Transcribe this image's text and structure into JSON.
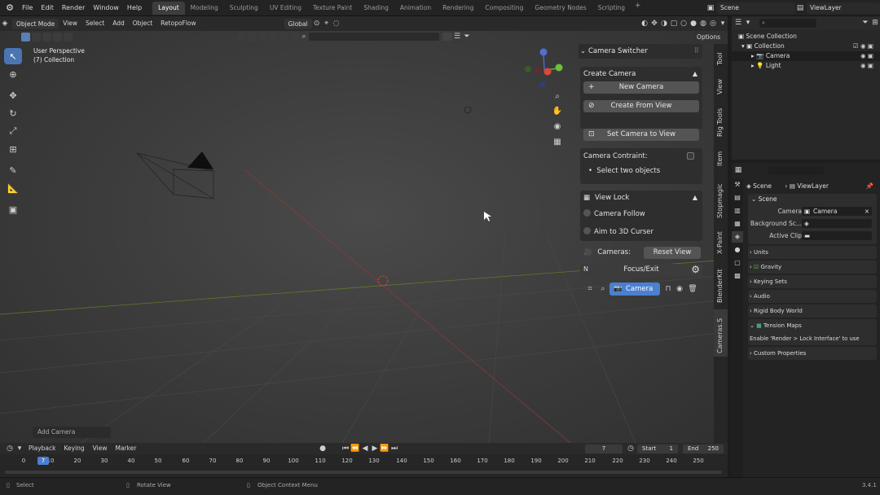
{
  "topbar": {
    "menus": [
      "File",
      "Edit",
      "Render",
      "Window",
      "Help"
    ],
    "workspaces": [
      "Layout",
      "Modeling",
      "Sculpting",
      "UV Editing",
      "Texture Paint",
      "Shading",
      "Animation",
      "Rendering",
      "Compositing",
      "Geometry Nodes",
      "Scripting"
    ],
    "active_workspace": "Layout",
    "scene": "Scene",
    "view_layer": "ViewLayer"
  },
  "viewport_header": {
    "mode": "Object Mode",
    "menus": [
      "View",
      "Select",
      "Add",
      "Object",
      "RetopoFlow"
    ],
    "transform_orientation": "Global",
    "options_label": "Options"
  },
  "viewport": {
    "perspective": "User Perspective",
    "collection": "(7) Collection",
    "last_operator": "Add Camera"
  },
  "npanel": {
    "title": "Camera Switcher",
    "create_camera": {
      "title": "Create Camera",
      "new_camera": "New Camera",
      "create_from_view": "Create From View",
      "set_camera_to_view": "Set Camera to View"
    },
    "contraint": {
      "label": "Camera Contraint:",
      "hint": "Select two objects"
    },
    "view_lock": {
      "title": "View Lock",
      "camera_follow": "Camera Follow",
      "aim_to_cursor": "Aim to 3D Curser"
    },
    "cameras_label": "Cameras:",
    "reset_view": "Reset View",
    "n_key": "N",
    "focus_exit": "Focus/Exit",
    "camera_item": "Camera",
    "tabs": [
      "Tool",
      "View",
      "Rig Tools",
      "Item",
      "Stopmagic",
      "X-Paint",
      "BlenderKit",
      "Cameras.S"
    ]
  },
  "outliner": {
    "scene_collection": "Scene Collection",
    "collection": "Collection",
    "camera": "Camera",
    "light": "Light"
  },
  "properties": {
    "crumb_scene": "Scene",
    "crumb_layer": "ViewLayer",
    "scene_panel": "Scene",
    "camera_label": "Camera",
    "camera_value": "Camera",
    "bg_label": "Background Sc...",
    "clip_label": "Active Clip",
    "units": "Units",
    "gravity": "Gravity",
    "keying_sets": "Keying Sets",
    "audio": "Audio",
    "rigid_body": "Rigid Body World",
    "tension_maps": "Tension Maps",
    "tension_note": "Enable 'Render > Lock Interface' to use",
    "custom_props": "Custom Properties"
  },
  "timeline": {
    "menus": [
      "Playback",
      "Keying",
      "View",
      "Marker"
    ],
    "current_frame": "7",
    "start_label": "Start",
    "start": "1",
    "end_label": "End",
    "end": "250",
    "playhead": "7",
    "ticks": [
      "0",
      "10",
      "20",
      "30",
      "40",
      "50",
      "60",
      "70",
      "80",
      "90",
      "100",
      "110",
      "120",
      "130",
      "140",
      "150",
      "160",
      "170",
      "180",
      "190",
      "200",
      "210",
      "220",
      "230",
      "240",
      "250"
    ]
  },
  "status": {
    "select": "Select",
    "rotate": "Rotate View",
    "context": "Object Context Menu",
    "version": "3.4.1"
  }
}
